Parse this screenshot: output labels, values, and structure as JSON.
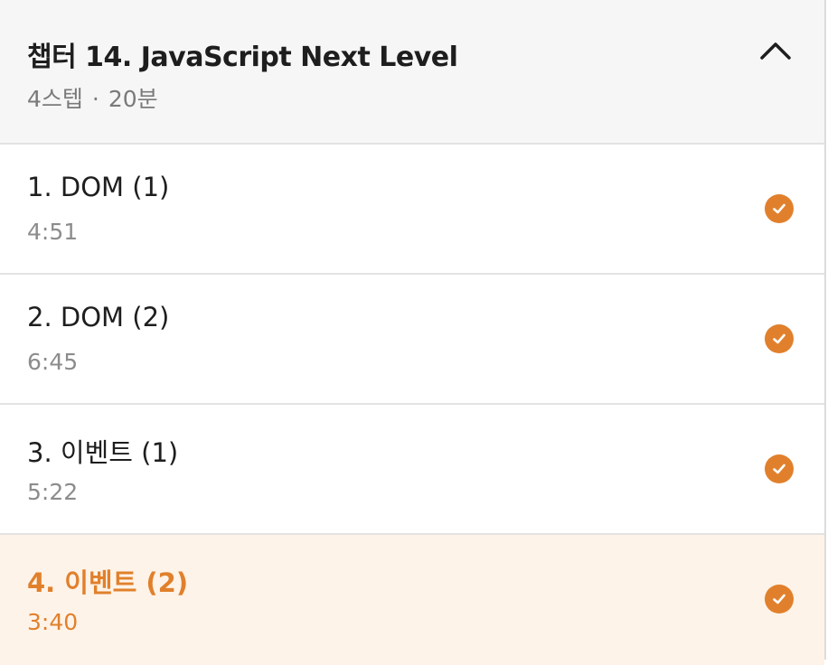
{
  "chapter": {
    "title": "챕터 14. JavaScript Next Level",
    "step_count": "4스텝",
    "separator": "·",
    "duration": "20분",
    "toggle_icon": "chevron-up-icon"
  },
  "steps": [
    {
      "title": "1. DOM (1)",
      "duration": "4:51",
      "completed": true,
      "active": false
    },
    {
      "title": "2. DOM (2)",
      "duration": "6:45",
      "completed": true,
      "active": false
    },
    {
      "title": "3. 이벤트 (1)",
      "duration": "5:22",
      "completed": true,
      "active": false
    },
    {
      "title": "4. 이벤트 (2)",
      "duration": "3:40",
      "completed": true,
      "active": true
    }
  ],
  "colors": {
    "accent": "#e1802c",
    "active_background": "#fef3e8",
    "header_background": "#f6f6f6",
    "muted_text": "#8c8c8c"
  }
}
